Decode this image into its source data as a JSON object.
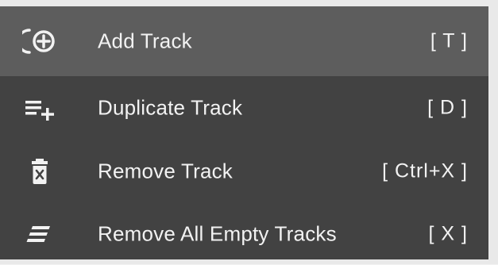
{
  "menu": {
    "items": [
      {
        "label": "Add Track",
        "shortcut": "[ T ]",
        "icon": "add-track-icon",
        "highlighted": true
      },
      {
        "label": "Duplicate Track",
        "shortcut": "[ D ]",
        "icon": "duplicate-track-icon",
        "highlighted": false
      },
      {
        "label": "Remove Track",
        "shortcut": "[ Ctrl+X ]",
        "icon": "trash-icon",
        "highlighted": false
      },
      {
        "label": "Remove All Empty Tracks",
        "shortcut": "[ X ]",
        "icon": "remove-empty-tracks-icon",
        "highlighted": false
      }
    ],
    "colors": {
      "background": "#424242",
      "highlight": "#5d5d5d",
      "text": "#f2f2f2",
      "border": "#e9e9e9"
    }
  }
}
